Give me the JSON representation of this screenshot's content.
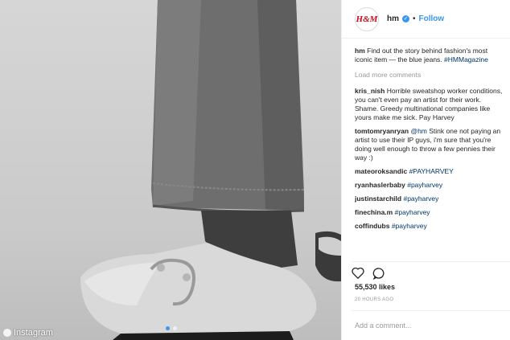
{
  "photo": {
    "credit": "Instagram",
    "carousel_dots": 2,
    "active_dot": 0
  },
  "header": {
    "avatar_text": "H&M",
    "username": "hm",
    "separator": "•",
    "follow_label": "Follow"
  },
  "caption": {
    "username": "hm",
    "text": "Find out the story behind fashion's most iconic item — the blue jeans.",
    "hashtag": "#HMMagazine"
  },
  "load_more_label": "Load more comments",
  "comments": [
    {
      "username": "kris_nish",
      "text": "Horrible sweatshop worker conditions, you can't even pay an artist for their work. Shame. Greedy multinational companies like yours make me sick. Pay Harvey"
    },
    {
      "username": "tomtomryanryan",
      "mention": "@hm",
      "text": "Stink one not paying an artist to use their IP guys, i'm sure that you're doing well enough to throw a few pennies their way :)"
    },
    {
      "username": "mateoroksandic",
      "hashtag": "#PAYHARVEY"
    },
    {
      "username": "ryanhaslerbaby",
      "hashtag": "#payharvey"
    },
    {
      "username": "justinstarchild",
      "hashtag": "#payharvey"
    },
    {
      "username": "finechina.m",
      "hashtag": "#payharvey"
    },
    {
      "username": "coffindubs",
      "hashtag": "#payharvey"
    }
  ],
  "likes": "55,530 likes",
  "timestamp": "20 HOURS AGO",
  "add_comment_placeholder": "Add a comment..."
}
